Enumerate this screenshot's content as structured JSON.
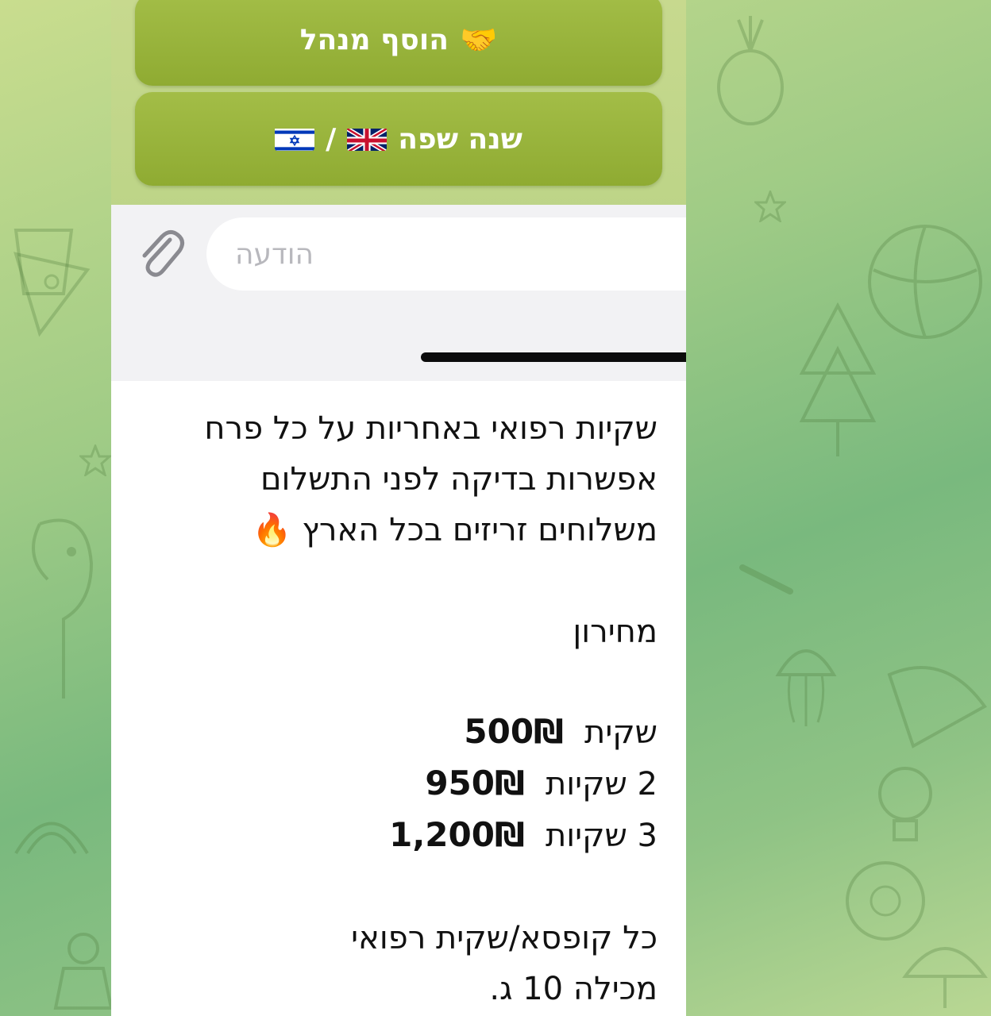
{
  "keyboard": {
    "add_admin": {
      "label": "הוסף מנהל",
      "icon": "handshake-emoji"
    },
    "change_language": {
      "label": "שנה שפה",
      "separator": "/",
      "flags": [
        "uk-flag",
        "israel-flag"
      ]
    }
  },
  "composer": {
    "placeholder": "הודעה",
    "attach_icon": "paperclip-icon"
  },
  "message": {
    "intro": [
      "שקיות רפואי באחריות על כל פרח",
      "אפשרות בדיקה לפני התשלום",
      "משלוחים זריזים בכל הארץ"
    ],
    "fire_emoji": "🔥",
    "price_heading": "מחירון",
    "prices": [
      {
        "item": "שקית",
        "price": "500₪"
      },
      {
        "item": "2 שקיות",
        "price": "950₪"
      },
      {
        "item": "3 שקיות",
        "price": "1,200₪"
      }
    ],
    "footer": [
      "כל קופסא/שקית רפואי",
      "מכילה 10 ג."
    ]
  },
  "colors": {
    "button_green": "#9ab43e",
    "wallpaper": "#86bf80",
    "card": "#ffffff"
  }
}
